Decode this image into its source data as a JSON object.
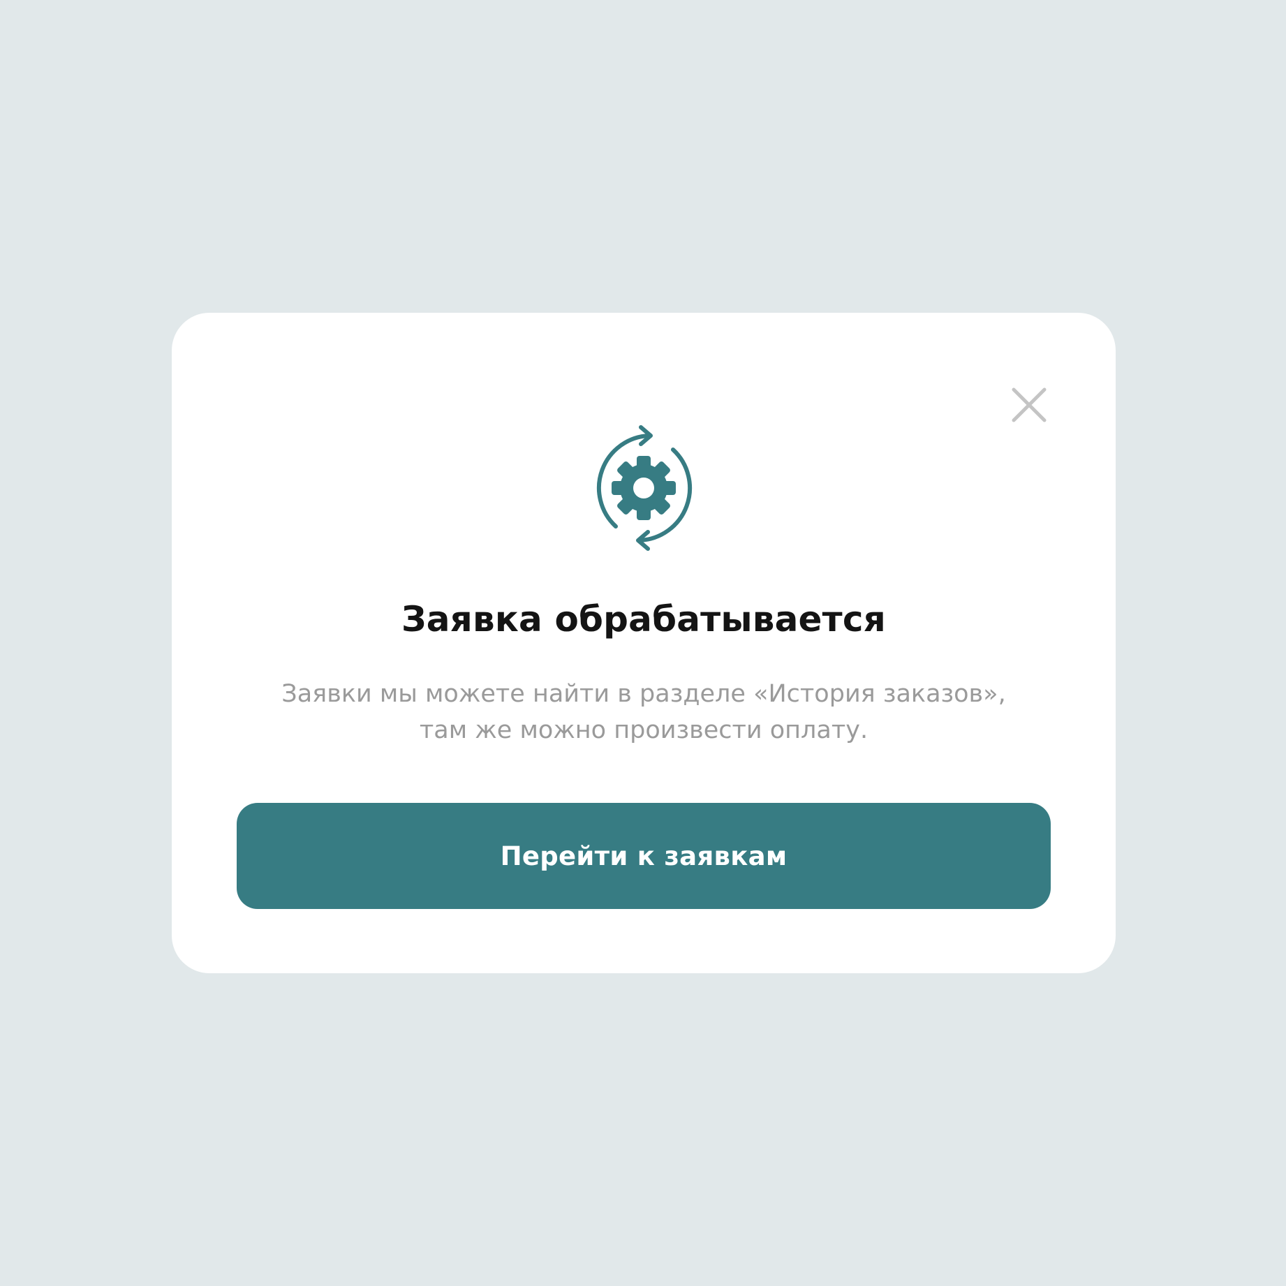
{
  "theme": {
    "backdrop": "#e1e8ea",
    "surface": "#ffffff",
    "accent": "#377c83",
    "title_color": "#141414",
    "text_muted": "#9a9a9a",
    "close_icon_color": "#c4c4c4"
  },
  "modal": {
    "status_icon": "gear-refresh-icon",
    "close_icon": "close-icon",
    "title": "Заявка обрабатывается",
    "description_lines": [
      "Заявки мы можете найти в разделе «История заказов»,",
      "там же можно произвести оплату."
    ],
    "primary_button_label": "Перейти к заявкам"
  }
}
